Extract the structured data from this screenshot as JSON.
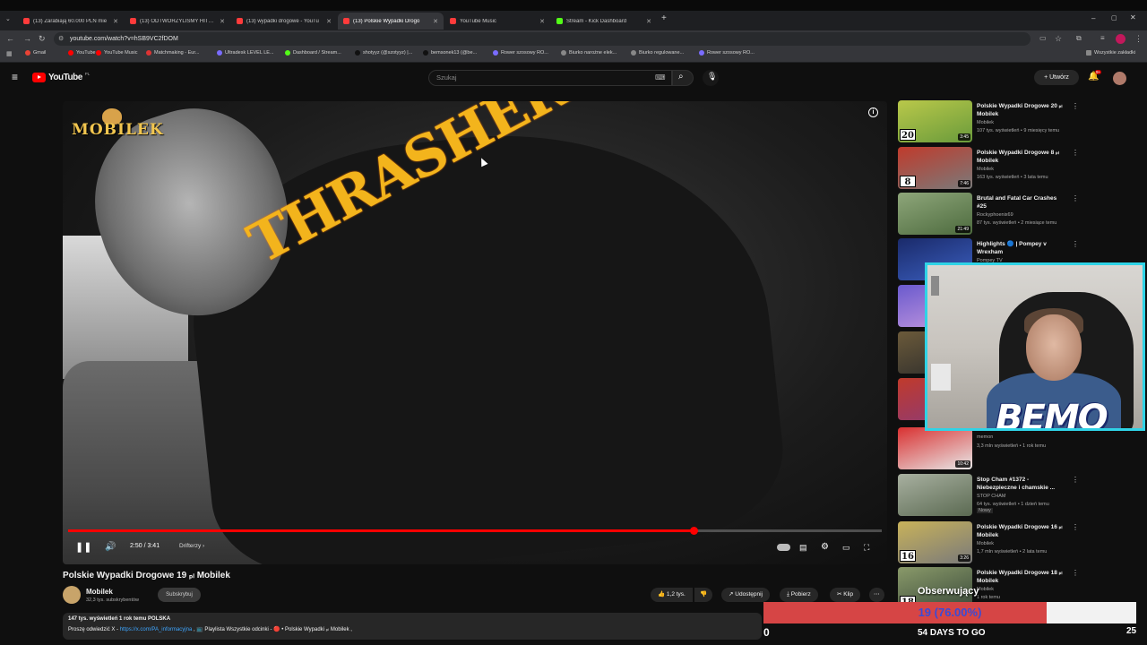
{
  "browser": {
    "tabs": [
      {
        "label": "(13) Zarabiają 60.000 PLN mie",
        "color": "#ff3b3b",
        "active": false
      },
      {
        "label": "(13) ODTWORZYLIŚMY HITY P",
        "color": "#ff3b3b",
        "active": false
      },
      {
        "label": "(13) wypadki drogowe - YouTu",
        "color": "#ff3b3b",
        "active": false
      },
      {
        "label": "(13) Polskie Wypadki Drogo",
        "color": "#ff3b3b",
        "active": true
      },
      {
        "label": "YouTube Music",
        "color": "#ff3b3b",
        "active": false
      },
      {
        "label": "Stream - Kick Dashboard",
        "color": "#53fc18",
        "active": false
      }
    ],
    "url": "youtube.com/watch?v=hSB9VC2fDOM",
    "bookmarks": [
      {
        "label": "Gmail",
        "color": "#ea4335"
      },
      {
        "label": "YouTube",
        "color": "#ff0000"
      },
      {
        "label": "YouTube Music",
        "color": "#ff0000"
      },
      {
        "label": "Matchmaking - Eur...",
        "color": "#d33"
      },
      {
        "label": "Ultradesk LEVEL LE...",
        "color": "#7a6cff"
      },
      {
        "label": "Dashboard / Stream...",
        "color": "#53fc18"
      },
      {
        "label": "shotyyz (@szotyyz) |...",
        "color": "#111"
      },
      {
        "label": "bemsonek13 (@be...",
        "color": "#111"
      },
      {
        "label": "Rower szosowy RO...",
        "color": "#7a6cff"
      },
      {
        "label": "Biurko narożne elek...",
        "color": "#888"
      },
      {
        "label": "Biurko regulowane...",
        "color": "#888"
      },
      {
        "label": "Rower szosowy RO...",
        "color": "#7a6cff"
      }
    ],
    "all_bookmarks": "Wszystkie zakładki"
  },
  "youtube": {
    "logo": "YouTube",
    "logo_region": "PL",
    "search_placeholder": "Szukaj",
    "create_label": "Utwórz",
    "notif_count": "9+"
  },
  "video": {
    "overlay_logo": "MOBILEK",
    "time": "2:50 / 3:41",
    "chapter": "Drifterzy",
    "progress": 0.769,
    "title": "Polskie Wypadki Drogowe 19 ₚₗ Mobilek",
    "channel": "Mobilek",
    "subs": "32,3 tys. subskrybentów",
    "subscribe": "Subskrybuj",
    "likes": "1,2 tys.",
    "share": "Udostępnij",
    "download": "Pobierz",
    "clip": "Klip",
    "desc_stats": "147 tys. wyświetleń  1 rok temu  POLSKA",
    "desc_prefix": "Proszę odwiedzić X - ",
    "desc_link": "https://x.com/PA_informacyjna",
    "desc_rest": " , 📺 Playlista Wszystkie odcinki - 🔴 • Polskie Wypadki ₚₗ Mobilek ,"
  },
  "recommendations": [
    {
      "title": "Polskie Wypadki Drogowe 20 ₚₗ Mobilek",
      "channel": "Mobilek",
      "meta": "107 tys. wyświetleń • 9 miesięcy temu",
      "dur": "3:45",
      "badge": "20",
      "colors": [
        "#b9c84a",
        "#6a9b3b"
      ]
    },
    {
      "title": "Polskie Wypadki Drogowe 8 ₚₗ Mobilek",
      "channel": "Mobilek",
      "meta": "163 tys. wyświetleń • 3 lata temu",
      "dur": "7:46",
      "badge": "8",
      "colors": [
        "#c03a2b",
        "#7a7a7a"
      ]
    },
    {
      "title": "Brutal and Fatal Car Crashes #25",
      "channel": "Rockyphoenix69",
      "meta": "87 tys. wyświetleń • 2 miesiące temu",
      "dur": "21:49",
      "badge": "",
      "colors": [
        "#8ea67a",
        "#4d6b3e"
      ]
    },
    {
      "title": "Highlights 🔵 | Pompey v Wrexham",
      "channel": "Pompey TV",
      "meta": "",
      "dur": "",
      "badge": "",
      "colors": [
        "#1a2a6a",
        "#3b5fbf"
      ]
    },
    {
      "title": "",
      "channel": "",
      "meta": "",
      "dur": "",
      "badge": "",
      "colors": [
        "#6a5acd",
        "#c89be0"
      ]
    },
    {
      "title": "",
      "channel": "",
      "meta": "",
      "dur": "",
      "badge": "",
      "colors": [
        "#6b5a3a",
        "#2b2b2b"
      ]
    },
    {
      "title": "",
      "channel": "",
      "meta": "",
      "dur": "",
      "badge": "",
      "colors": [
        "#c03a2b",
        "#8a3b7a"
      ]
    },
    {
      "title": "",
      "channel": "memon",
      "meta": "3,3 mln wyświetleń • 1 rok temu",
      "dur": "10:42",
      "badge": "",
      "colors": [
        "#d93030",
        "#e8e8e8"
      ]
    },
    {
      "title": "Stop Cham #1372 - Niebezpieczne i chamskie ...",
      "channel": "STOP CHAM",
      "meta": "64 tys. wyświetleń • 1 dzień temu",
      "dur": "",
      "badge": "",
      "tag": "Nowy",
      "colors": [
        "#a8b0a0",
        "#5b6a52"
      ]
    },
    {
      "title": "Polskie Wypadki Drogowe 16 ₚₗ Mobilek",
      "channel": "Mobilek",
      "meta": "1,7 mln wyświetleń • 2 lata temu",
      "dur": "3:26",
      "badge": "16",
      "colors": [
        "#c8b25a",
        "#7a7a7a"
      ]
    },
    {
      "title": "Polskie Wypadki Drogowe 18 ₚₗ Mobilek",
      "channel": "Mobilek",
      "meta": "1 rok temu",
      "dur": "",
      "badge": "18",
      "colors": [
        "#8a9a6a",
        "#3a4a3a"
      ]
    }
  ],
  "overlay": {
    "streamer": "BEMO",
    "goal_label": "Obserwujący",
    "goal_text": "19 (76.00%)",
    "goal_fraction": 0.76,
    "goal_start": "0",
    "goal_end": "25",
    "days_left": "54 DAYS TO GO"
  }
}
